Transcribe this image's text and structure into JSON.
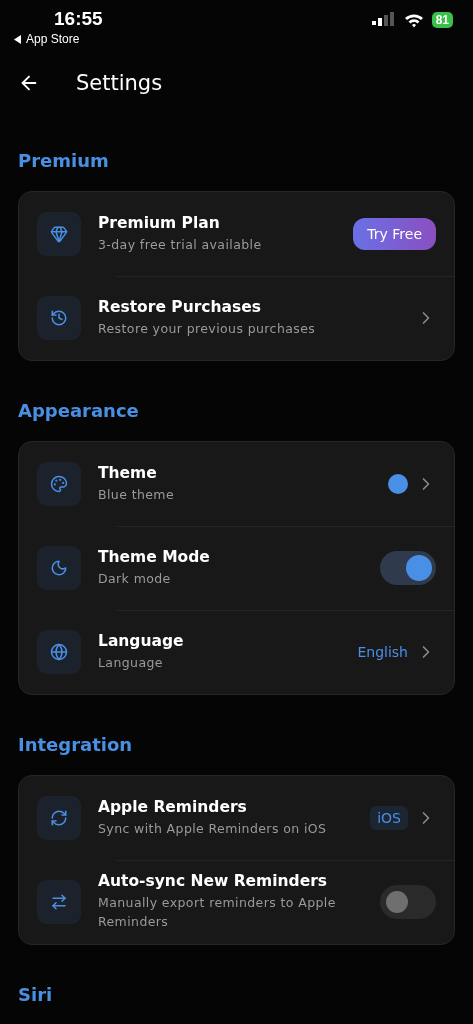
{
  "status_bar": {
    "time": "16:55",
    "back_label": "App Store",
    "battery": "81"
  },
  "header": {
    "title": "Settings"
  },
  "sections": [
    {
      "title": "Premium",
      "rows": [
        {
          "kind": "button",
          "title": "Premium Plan",
          "subtitle": "3-day free trial available",
          "action": "Try Free"
        },
        {
          "kind": "chevron",
          "title": "Restore Purchases",
          "subtitle": "Restore your previous purchases"
        }
      ]
    },
    {
      "title": "Appearance",
      "rows": [
        {
          "kind": "color",
          "title": "Theme",
          "subtitle": "Blue theme",
          "color": "#4a8fe6"
        },
        {
          "kind": "toggle",
          "title": "Theme Mode",
          "subtitle": "Dark mode",
          "on": true
        },
        {
          "kind": "value",
          "title": "Language",
          "subtitle": "Language",
          "value": "English"
        }
      ]
    },
    {
      "title": "Integration",
      "rows": [
        {
          "kind": "badge",
          "title": "Apple Reminders",
          "subtitle": "Sync with Apple Reminders on iOS",
          "badge": "iOS"
        },
        {
          "kind": "toggle",
          "title": "Auto-sync New Reminders",
          "subtitle": "Manually export reminders to Apple Reminders",
          "on": false
        }
      ]
    },
    {
      "title": "Siri"
    }
  ]
}
